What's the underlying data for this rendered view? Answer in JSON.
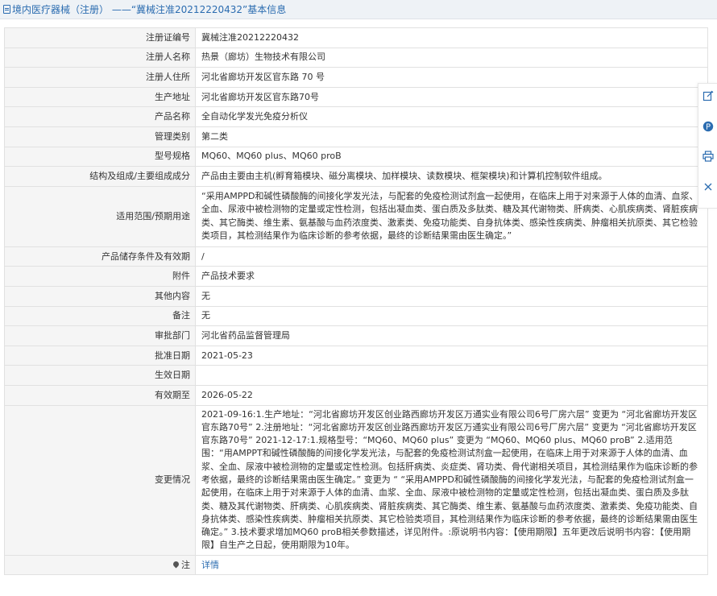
{
  "header": {
    "title": "境内医疗器械（注册） ——“冀械注准20212220432”基本信息"
  },
  "rows": [
    {
      "label": "注册证编号",
      "value": "冀械注准20212220432"
    },
    {
      "label": "注册人名称",
      "value": "热景（廊坊）生物技术有限公司"
    },
    {
      "label": "注册人住所",
      "value": "河北省廊坊开发区官东路 70 号"
    },
    {
      "label": "生产地址",
      "value": "河北省廊坊开发区官东路70号"
    },
    {
      "label": "产品名称",
      "value": "全自动化学发光免疫分析仪"
    },
    {
      "label": "管理类别",
      "value": "第二类"
    },
    {
      "label": "型号规格",
      "value": "MQ60、MQ60 plus、MQ60 proB"
    },
    {
      "label": "结构及组成/主要组成成分",
      "value": "产品由主要由主机(孵育箱模块、磁分离模块、加样模块、读数模块、框架模块)和计算机控制软件组成。"
    },
    {
      "label": "适用范围/预期用途",
      "value": "“采用AMPPD和碱性磷酸酶的间接化学发光法，与配套的免疫检测试剂盒一起使用，在临床上用于对来源于人体的血清、血浆、全血、尿液中被检测物的定量或定性检测，包括出凝血类、蛋白质及多肽类、糖及其代谢物类、肝病类、心肌疾病类、肾脏疾病类、其它酶类、维生素、氨基酸与血药浓度类、激素类、免疫功能类、自身抗体类、感染性疾病类、肿瘤相关抗原类、其它检验类项目，其检测结果作为临床诊断的参考依据，最终的诊断结果需由医生确定。”"
    },
    {
      "label": "产品储存条件及有效期",
      "value": "/"
    },
    {
      "label": "附件",
      "value": "产品技术要求"
    },
    {
      "label": "其他内容",
      "value": "无"
    },
    {
      "label": "备注",
      "value": "无"
    },
    {
      "label": "审批部门",
      "value": "河北省药品监督管理局"
    },
    {
      "label": "批准日期",
      "value": "2021-05-23"
    },
    {
      "label": "生效日期",
      "value": ""
    },
    {
      "label": "有效期至",
      "value": "2026-05-22"
    },
    {
      "label": "变更情况",
      "value": "2021-09-16:1.生产地址：“河北省廊坊开发区创业路西廊坊开发区万通实业有限公司6号厂房六层” 变更为 “河北省廊坊开发区官东路70号” 2.注册地址：“河北省廊坊开发区创业路西廊坊开发区万通实业有限公司6号厂房六层” 变更为 “河北省廊坊开发区官东路70号” 2021-12-17:1.规格型号：“MQ60、MQ60 plus” 变更为 “MQ60、MQ60 plus、MQ60 proB” 2.适用范围：“用AMPPT和碱性磷酸酶的间接化学发光法，与配套的免疫检测试剂盒一起使用，在临床上用于对来源于人体的血清、血浆、全血、尿液中被检测物的定量或定性检测。包括肝病类、炎症类、肾功类、骨代谢相关项目，其检测结果作为临床诊断的参考依据，最终的诊断结果需由医生确定。” 变更为 “ “采用AMPPD和碱性磷酸酶的间接化学发光法，与配套的免疫检测试剂盒一起使用，在临床上用于对来源于人体的血清、血浆、全血、尿液中被检测物的定量或定性检测，包括出凝血类、蛋白质及多肽类、糖及其代谢物类、肝病类、心肌疾病类、肾脏疾病类、其它酶类、维生素、氨基酸与血药浓度类、激素类、免疫功能类、自身抗体类、感染性疾病类、肿瘤相关抗原类、其它检验类项目，其检测结果作为临床诊断的参考依据，最终的诊断结果需由医生确定。” 3.技术要求增加MQ60 proB相关参数描述，详见附件。:原说明书内容：【使用期限】五年更改后说明书内容：【使用期限】自生产之日起，使用期限为10年。"
    },
    {
      "label": "注",
      "value": "详情"
    }
  ],
  "toolbar": {
    "icons": [
      "edit-icon",
      "p-circle-icon",
      "print-icon",
      "close-icon"
    ],
    "accent": "#2b6cb0"
  }
}
